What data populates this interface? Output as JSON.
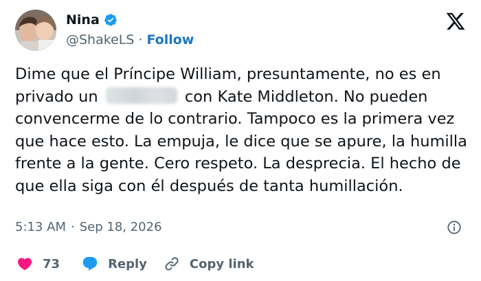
{
  "author": {
    "name": "Nina",
    "handle": "@ShakeLS",
    "follow_label": "Follow"
  },
  "tweet": {
    "text_before": "Dime que el Príncipe William, presuntamente, no es en privado un",
    "text_after": "con Kate Middleton. No pueden convencerme de lo contrario. Tampoco es la primera vez que hace esto. La empuja, le dice que se apure, la humilla frente a la gente. Cero respeto. La desprecia. El hecho de que ella siga con él después de tanta humillación."
  },
  "meta": {
    "time": "5:13 AM",
    "separator": "·",
    "date": "Sep 18, 2026"
  },
  "actions": {
    "likes": "73",
    "reply_label": "Reply",
    "copy_label": "Copy link"
  },
  "icons": {
    "verified": "verified-badge-icon",
    "x_logo": "x-logo-icon",
    "info": "info-icon",
    "heart": "heart-icon",
    "reply": "reply-bubble-icon",
    "link": "link-icon"
  },
  "colors": {
    "follow": "#1d76c3",
    "verified": "#1d9bf0",
    "heart": "#f91880",
    "reply": "#1d9bf0",
    "muted": "#536471"
  }
}
